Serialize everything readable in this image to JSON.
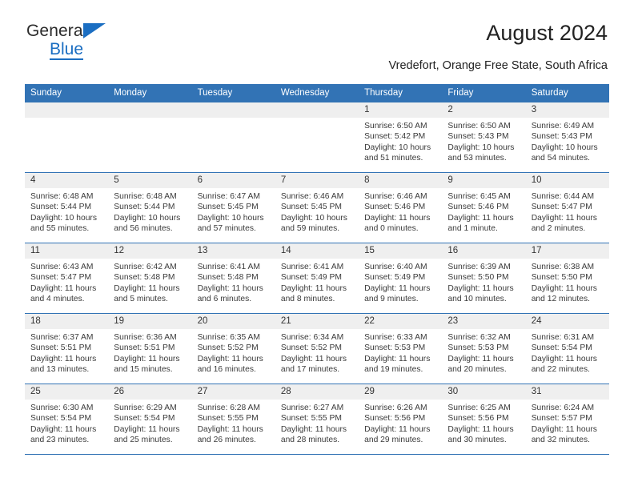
{
  "brand": {
    "name_top": "General",
    "name_bottom": "Blue",
    "accent_color": "#1b6ec2"
  },
  "header": {
    "title": "August 2024",
    "subtitle": "Vredefort, Orange Free State, South Africa",
    "header_bg": "#3273b5",
    "daynum_bg": "#efefef"
  },
  "weekdays": [
    "Sunday",
    "Monday",
    "Tuesday",
    "Wednesday",
    "Thursday",
    "Friday",
    "Saturday"
  ],
  "labels": {
    "sunrise_prefix": "Sunrise:",
    "sunset_prefix": "Sunset:",
    "daylight_prefix": "Daylight:"
  },
  "weeks": [
    [
      {
        "day": "",
        "blank": true
      },
      {
        "day": "",
        "blank": true
      },
      {
        "day": "",
        "blank": true
      },
      {
        "day": "",
        "blank": true
      },
      {
        "day": "1",
        "sunrise": "Sunrise: 6:50 AM",
        "sunset": "Sunset: 5:42 PM",
        "daylight_line1": "Daylight: 10 hours",
        "daylight_line2": "and 51 minutes."
      },
      {
        "day": "2",
        "sunrise": "Sunrise: 6:50 AM",
        "sunset": "Sunset: 5:43 PM",
        "daylight_line1": "Daylight: 10 hours",
        "daylight_line2": "and 53 minutes."
      },
      {
        "day": "3",
        "sunrise": "Sunrise: 6:49 AM",
        "sunset": "Sunset: 5:43 PM",
        "daylight_line1": "Daylight: 10 hours",
        "daylight_line2": "and 54 minutes."
      }
    ],
    [
      {
        "day": "4",
        "sunrise": "Sunrise: 6:48 AM",
        "sunset": "Sunset: 5:44 PM",
        "daylight_line1": "Daylight: 10 hours",
        "daylight_line2": "and 55 minutes."
      },
      {
        "day": "5",
        "sunrise": "Sunrise: 6:48 AM",
        "sunset": "Sunset: 5:44 PM",
        "daylight_line1": "Daylight: 10 hours",
        "daylight_line2": "and 56 minutes."
      },
      {
        "day": "6",
        "sunrise": "Sunrise: 6:47 AM",
        "sunset": "Sunset: 5:45 PM",
        "daylight_line1": "Daylight: 10 hours",
        "daylight_line2": "and 57 minutes."
      },
      {
        "day": "7",
        "sunrise": "Sunrise: 6:46 AM",
        "sunset": "Sunset: 5:45 PM",
        "daylight_line1": "Daylight: 10 hours",
        "daylight_line2": "and 59 minutes."
      },
      {
        "day": "8",
        "sunrise": "Sunrise: 6:46 AM",
        "sunset": "Sunset: 5:46 PM",
        "daylight_line1": "Daylight: 11 hours",
        "daylight_line2": "and 0 minutes."
      },
      {
        "day": "9",
        "sunrise": "Sunrise: 6:45 AM",
        "sunset": "Sunset: 5:46 PM",
        "daylight_line1": "Daylight: 11 hours",
        "daylight_line2": "and 1 minute."
      },
      {
        "day": "10",
        "sunrise": "Sunrise: 6:44 AM",
        "sunset": "Sunset: 5:47 PM",
        "daylight_line1": "Daylight: 11 hours",
        "daylight_line2": "and 2 minutes."
      }
    ],
    [
      {
        "day": "11",
        "sunrise": "Sunrise: 6:43 AM",
        "sunset": "Sunset: 5:47 PM",
        "daylight_line1": "Daylight: 11 hours",
        "daylight_line2": "and 4 minutes."
      },
      {
        "day": "12",
        "sunrise": "Sunrise: 6:42 AM",
        "sunset": "Sunset: 5:48 PM",
        "daylight_line1": "Daylight: 11 hours",
        "daylight_line2": "and 5 minutes."
      },
      {
        "day": "13",
        "sunrise": "Sunrise: 6:41 AM",
        "sunset": "Sunset: 5:48 PM",
        "daylight_line1": "Daylight: 11 hours",
        "daylight_line2": "and 6 minutes."
      },
      {
        "day": "14",
        "sunrise": "Sunrise: 6:41 AM",
        "sunset": "Sunset: 5:49 PM",
        "daylight_line1": "Daylight: 11 hours",
        "daylight_line2": "and 8 minutes."
      },
      {
        "day": "15",
        "sunrise": "Sunrise: 6:40 AM",
        "sunset": "Sunset: 5:49 PM",
        "daylight_line1": "Daylight: 11 hours",
        "daylight_line2": "and 9 minutes."
      },
      {
        "day": "16",
        "sunrise": "Sunrise: 6:39 AM",
        "sunset": "Sunset: 5:50 PM",
        "daylight_line1": "Daylight: 11 hours",
        "daylight_line2": "and 10 minutes."
      },
      {
        "day": "17",
        "sunrise": "Sunrise: 6:38 AM",
        "sunset": "Sunset: 5:50 PM",
        "daylight_line1": "Daylight: 11 hours",
        "daylight_line2": "and 12 minutes."
      }
    ],
    [
      {
        "day": "18",
        "sunrise": "Sunrise: 6:37 AM",
        "sunset": "Sunset: 5:51 PM",
        "daylight_line1": "Daylight: 11 hours",
        "daylight_line2": "and 13 minutes."
      },
      {
        "day": "19",
        "sunrise": "Sunrise: 6:36 AM",
        "sunset": "Sunset: 5:51 PM",
        "daylight_line1": "Daylight: 11 hours",
        "daylight_line2": "and 15 minutes."
      },
      {
        "day": "20",
        "sunrise": "Sunrise: 6:35 AM",
        "sunset": "Sunset: 5:52 PM",
        "daylight_line1": "Daylight: 11 hours",
        "daylight_line2": "and 16 minutes."
      },
      {
        "day": "21",
        "sunrise": "Sunrise: 6:34 AM",
        "sunset": "Sunset: 5:52 PM",
        "daylight_line1": "Daylight: 11 hours",
        "daylight_line2": "and 17 minutes."
      },
      {
        "day": "22",
        "sunrise": "Sunrise: 6:33 AM",
        "sunset": "Sunset: 5:53 PM",
        "daylight_line1": "Daylight: 11 hours",
        "daylight_line2": "and 19 minutes."
      },
      {
        "day": "23",
        "sunrise": "Sunrise: 6:32 AM",
        "sunset": "Sunset: 5:53 PM",
        "daylight_line1": "Daylight: 11 hours",
        "daylight_line2": "and 20 minutes."
      },
      {
        "day": "24",
        "sunrise": "Sunrise: 6:31 AM",
        "sunset": "Sunset: 5:54 PM",
        "daylight_line1": "Daylight: 11 hours",
        "daylight_line2": "and 22 minutes."
      }
    ],
    [
      {
        "day": "25",
        "sunrise": "Sunrise: 6:30 AM",
        "sunset": "Sunset: 5:54 PM",
        "daylight_line1": "Daylight: 11 hours",
        "daylight_line2": "and 23 minutes."
      },
      {
        "day": "26",
        "sunrise": "Sunrise: 6:29 AM",
        "sunset": "Sunset: 5:54 PM",
        "daylight_line1": "Daylight: 11 hours",
        "daylight_line2": "and 25 minutes."
      },
      {
        "day": "27",
        "sunrise": "Sunrise: 6:28 AM",
        "sunset": "Sunset: 5:55 PM",
        "daylight_line1": "Daylight: 11 hours",
        "daylight_line2": "and 26 minutes."
      },
      {
        "day": "28",
        "sunrise": "Sunrise: 6:27 AM",
        "sunset": "Sunset: 5:55 PM",
        "daylight_line1": "Daylight: 11 hours",
        "daylight_line2": "and 28 minutes."
      },
      {
        "day": "29",
        "sunrise": "Sunrise: 6:26 AM",
        "sunset": "Sunset: 5:56 PM",
        "daylight_line1": "Daylight: 11 hours",
        "daylight_line2": "and 29 minutes."
      },
      {
        "day": "30",
        "sunrise": "Sunrise: 6:25 AM",
        "sunset": "Sunset: 5:56 PM",
        "daylight_line1": "Daylight: 11 hours",
        "daylight_line2": "and 30 minutes."
      },
      {
        "day": "31",
        "sunrise": "Sunrise: 6:24 AM",
        "sunset": "Sunset: 5:57 PM",
        "daylight_line1": "Daylight: 11 hours",
        "daylight_line2": "and 32 minutes."
      }
    ]
  ]
}
